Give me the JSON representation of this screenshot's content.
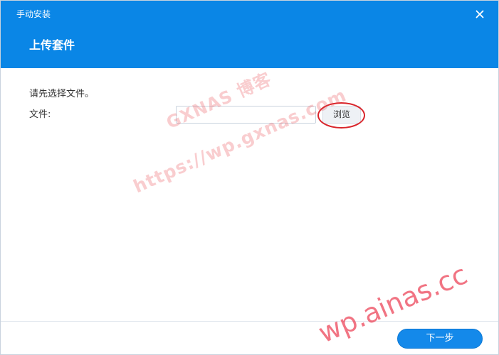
{
  "window": {
    "title": "手动安装",
    "close_icon": "close-icon"
  },
  "step": {
    "title": "上传套件"
  },
  "form": {
    "instruction": "请先选择文件。",
    "file_label": "文件:",
    "file_value": "",
    "browse_label": "浏览"
  },
  "footer": {
    "next_label": "下一步"
  },
  "watermarks": {
    "line1": "GXNAS 博客",
    "line2": "https://wp.gxnas.com",
    "line3": "wp.ainas.cc"
  },
  "colors": {
    "header": "#0a86e6",
    "primary_button": "#1489ea",
    "annotation": "#d9252b",
    "watermark": "#e84c54"
  }
}
